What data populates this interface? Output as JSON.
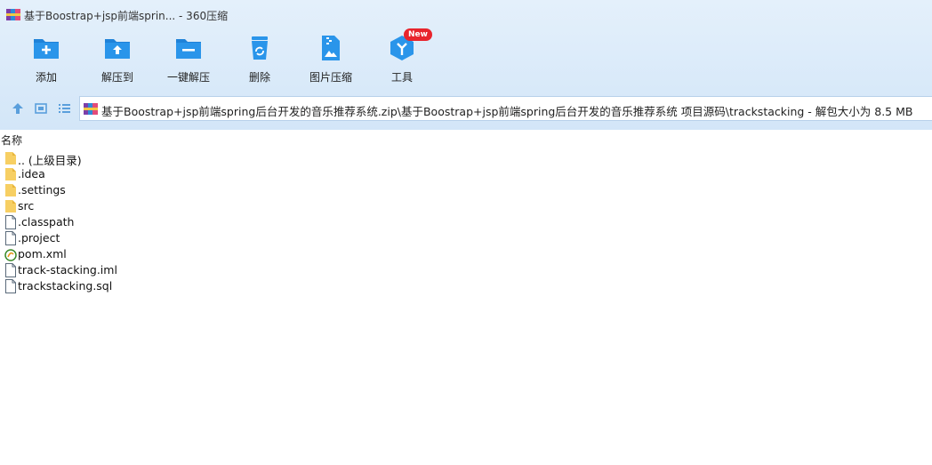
{
  "window": {
    "title": "基于Boostrap+jsp前端sprin... - 360压缩",
    "app_icon": "winrar-box-icon"
  },
  "toolbar": {
    "items": [
      {
        "label": "添加",
        "icon": "folder-add-icon"
      },
      {
        "label": "解压到",
        "icon": "folder-extract-icon"
      },
      {
        "label": "一键解压",
        "icon": "folder-oneclick-icon"
      },
      {
        "label": "删除",
        "icon": "recycle-bin-icon"
      },
      {
        "label": "图片压缩",
        "icon": "image-zip-icon"
      },
      {
        "label": "工具",
        "icon": "tools-cube-icon",
        "badge": "New"
      }
    ]
  },
  "address": {
    "path": "基于Boostrap+jsp前端spring后台开发的音乐推荐系统.zip\\基于Boostrap+jsp前端spring后台开发的音乐推荐系统 项目源码\\trackstacking - 解包大小为 8.5 MB"
  },
  "list": {
    "column_name": "名称",
    "items": [
      {
        "name": ".. (上级目录)",
        "type": "folder"
      },
      {
        "name": ".idea",
        "type": "folder"
      },
      {
        "name": ".settings",
        "type": "folder"
      },
      {
        "name": "src",
        "type": "folder"
      },
      {
        "name": ".classpath",
        "type": "file"
      },
      {
        "name": ".project",
        "type": "file"
      },
      {
        "name": "pom.xml",
        "type": "xml"
      },
      {
        "name": "track-stacking.iml",
        "type": "file"
      },
      {
        "name": "trackstacking.sql",
        "type": "file"
      }
    ]
  },
  "colors": {
    "accent": "#2a8ee0",
    "folder": "#f7cf63",
    "badge": "#e8242c"
  }
}
